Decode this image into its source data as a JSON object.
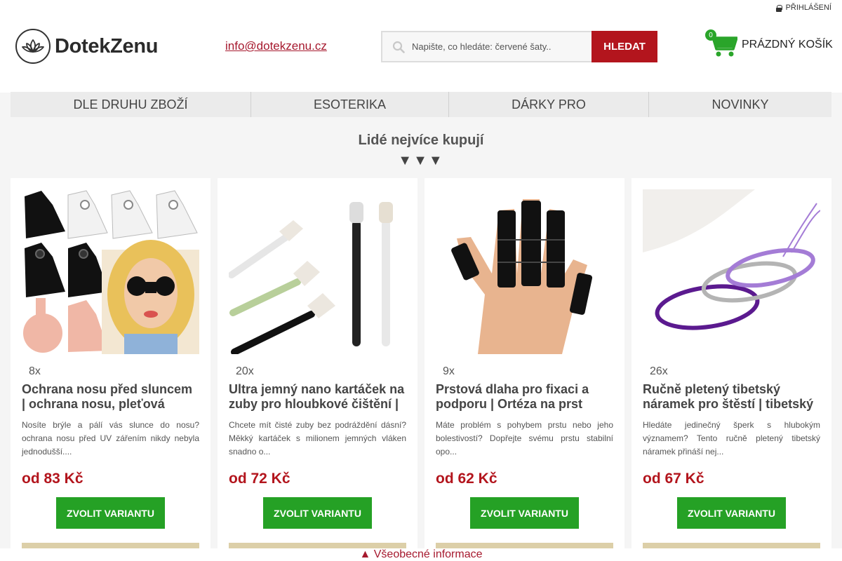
{
  "header": {
    "login_label": "PŘIHLÁŠENÍ",
    "logo_text": "DotekZenu",
    "email": "info@dotekzenu.cz",
    "search_placeholder": "Napište, co hledáte: červené šaty..",
    "search_button": "HLEDAT",
    "cart_count": "0",
    "cart_label": "PRÁZDNÝ KOŠÍK"
  },
  "nav": {
    "items": [
      {
        "label": "DLE DRUHU ZBOŽÍ"
      },
      {
        "label": "ESOTERIKA"
      },
      {
        "label": "DÁRKY PRO"
      },
      {
        "label": "NOVINKY"
      }
    ]
  },
  "section": {
    "title": "Lidé nejvíce kupují",
    "arrows": "▼▼▼"
  },
  "products": [
    {
      "sold": "8x",
      "title": "Ochrana nosu před sluncem | ochrana nosu, pleťová",
      "description": "Nosíte brýle a pálí vás slunce do nosu? ochrana nosu před UV zářením nikdy nebyla jednodušší....",
      "price": "od 83 Kč",
      "button": "ZVOLIT VARIANTU"
    },
    {
      "sold": "20x",
      "title": "Ultra jemný nano kartáček na zuby pro hloubkové čištění |",
      "description": "Chcete mít čisté zuby bez podráždění dásní? Měkký kartáček s milionem jemných vláken snadno o...",
      "price": "od 72 Kč",
      "button": "ZVOLIT VARIANTU"
    },
    {
      "sold": "9x",
      "title": "Prstová dlaha pro fixaci a podporu | Ortéza na prst",
      "description": "  Máte problém s pohybem prstu nebo jeho bolestivostí?  Dopřejte svému prstu stabilní opo...",
      "price": "od 62 Kč",
      "button": "ZVOLIT VARIANTU"
    },
    {
      "sold": "26x",
      "title": "Ručně pletený tibetský náramek pro štěstí | tibetský",
      "description": "Hledáte jedinečný šperk s hlubokým významem?  Tento ručně pletený tibetský náramek přináší nej...",
      "price": "od 67 Kč",
      "button": "ZVOLIT VARIANTU"
    }
  ],
  "footer": {
    "toggle_label": "▲ Všeobecné informace"
  },
  "colors": {
    "accent_red": "#b3151d",
    "link_red": "#a6192e",
    "button_green": "#25a125",
    "cart_green": "#2aa52a"
  }
}
